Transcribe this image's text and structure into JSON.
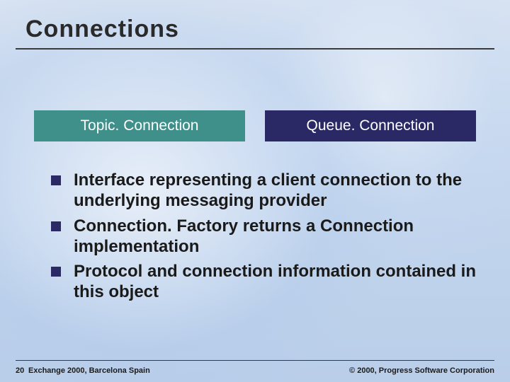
{
  "title": "Connections",
  "boxes": {
    "topic": "Topic. Connection",
    "queue": "Queue. Connection"
  },
  "bullets": [
    "Interface representing a client connection to the underlying messaging provider",
    "Connection. Factory returns a Connection implementation",
    "Protocol and connection information contained in this object"
  ],
  "footer": {
    "page": "20",
    "event": "Exchange 2000, Barcelona Spain",
    "copyright": "© 2000, Progress Software Corporation"
  }
}
